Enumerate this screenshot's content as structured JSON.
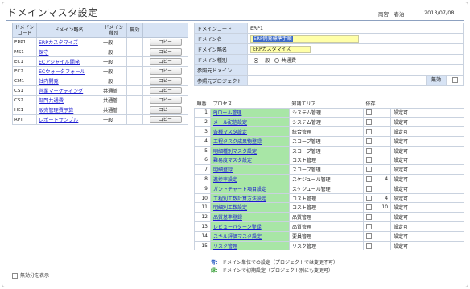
{
  "header": {
    "title": "ドメインマスタ設定",
    "user": "雨宮　春治",
    "date": "2013/07/08"
  },
  "left_table": {
    "columns": [
      "ドメイン\nコード",
      "ドメイン略名",
      "ドメイン\n種別",
      "無効",
      ""
    ],
    "copy_label": "コピー",
    "rows": [
      {
        "code": "ERP1",
        "name": "ERPカスタマイズ",
        "kind": "一般"
      },
      {
        "code": "MS1",
        "name": "保守",
        "kind": "一般"
      },
      {
        "code": "EC1",
        "name": "ECアジャイル開発",
        "kind": "一般"
      },
      {
        "code": "EC2",
        "name": "ECウォータフォール",
        "kind": "一般"
      },
      {
        "code": "CM1",
        "name": "社内開発",
        "kind": "一般"
      },
      {
        "code": "CS1",
        "name": "営業マーケティング",
        "kind": "共通管"
      },
      {
        "code": "CS2",
        "name": "部門共通費",
        "kind": "共通管"
      },
      {
        "code": "HE1",
        "name": "販売管理費予算",
        "kind": "共通管"
      },
      {
        "code": "RPT",
        "name": "レポートサンプル",
        "kind": "一般"
      }
    ]
  },
  "form": {
    "code_label": "ドメインコード",
    "code_value": "ERP1",
    "name_label": "ドメイン名",
    "name_value": "ERP開発標準手順",
    "short_label": "ドメイン略名",
    "short_value": "ERPカスタマイズ",
    "kind_label": "ドメイン種別",
    "kind_opt1": "一般",
    "kind_opt2": "共通費",
    "ref_domain_label": "参照元ドメイン",
    "ref_project_label": "参照元プロジェクト",
    "invalid_label": "無効"
  },
  "process_table": {
    "col_order": "順番",
    "col_process": "プロセス",
    "col_area": "知識エリア",
    "col_dep": "依存",
    "rows": [
      {
        "no": "1",
        "process": "PJロール管理",
        "area": "システム管理",
        "dep": "",
        "status": "設定可"
      },
      {
        "no": "2",
        "process": "メール配信設定",
        "area": "システム管理",
        "dep": "",
        "status": "設定可"
      },
      {
        "no": "3",
        "process": "各種マスタ設定",
        "area": "統合管理",
        "dep": "",
        "status": "設定可"
      },
      {
        "no": "4",
        "process": "工程タスク成果物登録",
        "area": "スコープ管理",
        "dep": "",
        "status": "設定可"
      },
      {
        "no": "5",
        "process": "明細種別マスタ設定",
        "area": "スコープ管理",
        "dep": "",
        "status": "設定可"
      },
      {
        "no": "6",
        "process": "難易度マスタ設定",
        "area": "コスト管理",
        "dep": "",
        "status": "設定可"
      },
      {
        "no": "7",
        "process": "明細登録",
        "area": "スコープ管理",
        "dep": "",
        "status": "設定可"
      },
      {
        "no": "8",
        "process": "進捗率設定",
        "area": "スケジュール管理",
        "dep": "4",
        "status": "設定可"
      },
      {
        "no": "9",
        "process": "ガントチャート項目設定",
        "area": "スケジュール管理",
        "dep": "",
        "status": "設定可"
      },
      {
        "no": "10",
        "process": "工程別工数計算方法設定",
        "area": "コスト管理",
        "dep": "4",
        "status": "設定可"
      },
      {
        "no": "11",
        "process": "明細別工数設定",
        "area": "コスト管理",
        "dep": "10",
        "status": "設定可"
      },
      {
        "no": "12",
        "process": "品質基準登録",
        "area": "品質管理",
        "dep": "",
        "status": "設定可"
      },
      {
        "no": "13",
        "process": "レビューパターン登録",
        "area": "品質管理",
        "dep": "",
        "status": "設定可"
      },
      {
        "no": "14",
        "process": "スキル評価マスタ設定",
        "area": "要員管理",
        "dep": "",
        "status": "設定可"
      },
      {
        "no": "15",
        "process": "リスク管理",
        "area": "リスク管理",
        "dep": "",
        "status": "設定可"
      }
    ]
  },
  "legend": {
    "blue_key": "青：",
    "blue_text": "ドメイン単位での設定（プロジェクトでは変更不可）",
    "green_key": "緑：",
    "green_text": "ドメインで初期設定（プロジェクト別にも変更可）"
  },
  "footer": {
    "show_invalid": "無効分を表示"
  },
  "colors": {
    "header_bg": "#d7e3f4",
    "process_green": "#a8e6a6",
    "input_yellow": "#ffffa8",
    "link_blue": "#1a1ad0"
  }
}
